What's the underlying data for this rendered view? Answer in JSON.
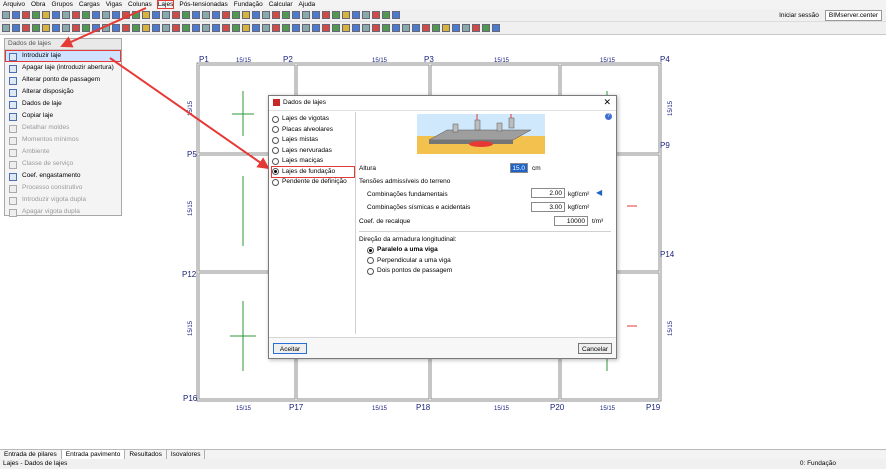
{
  "menu": [
    "Arquivo",
    "Obra",
    "Grupos",
    "Cargas",
    "Vigas",
    "Colunas",
    "Lajes",
    "Pós-tensionadas",
    "Fundação",
    "Calcular",
    "Ajuda"
  ],
  "menu_active_index": 6,
  "right_tools": {
    "login": "Iniciar sessão",
    "server": "BIMserver.center"
  },
  "plan": {
    "pillars": [
      "P1",
      "P2",
      "P3",
      "P4",
      "P5",
      "P9",
      "P12",
      "P14",
      "P16",
      "P17",
      "P18",
      "P20",
      "P19"
    ],
    "section": "15/15"
  },
  "side_menu": {
    "header": "Dados de lajes",
    "items": [
      {
        "label": "Introduzir laje",
        "enabled": true,
        "selected": true
      },
      {
        "label": "Apagar laje (introduzir abertura)",
        "enabled": true
      },
      {
        "label": "Alterar ponto de passagem",
        "enabled": true
      },
      {
        "label": "Alterar disposição",
        "enabled": true
      },
      {
        "label": "Dados de laje",
        "enabled": true
      },
      {
        "label": "Copiar laje",
        "enabled": true
      },
      {
        "label": "Detalhar moldes",
        "enabled": false
      },
      {
        "label": "Momentos mínimos",
        "enabled": false
      },
      {
        "label": "Ambiente",
        "enabled": false
      },
      {
        "label": "Classe de serviço",
        "enabled": false
      },
      {
        "label": "Coef. engastamento",
        "enabled": true
      },
      {
        "label": "Processo construtivo",
        "enabled": false
      },
      {
        "label": "Introduzir vigota dupla",
        "enabled": false
      },
      {
        "label": "Apagar vigota dupla",
        "enabled": false
      }
    ]
  },
  "dialog": {
    "title": "Dados de lajes",
    "types": [
      {
        "label": "Lajes de vigotas",
        "checked": false
      },
      {
        "label": "Placas alveolares",
        "checked": false
      },
      {
        "label": "Lajes mistas",
        "checked": false
      },
      {
        "label": "Lajes nervuradas",
        "checked": false
      },
      {
        "label": "Lajes maciças",
        "checked": false
      },
      {
        "label": "Lajes de fundação",
        "checked": true
      },
      {
        "label": "Pendente de definição",
        "checked": false
      }
    ],
    "altura_label": "Altura",
    "altura_value": "15.0",
    "altura_unit": "cm",
    "tensoes_label": "Tensões admissíveis do terreno",
    "comb_fund_label": "Combinações fundamentais",
    "comb_fund_value": "2.00",
    "comb_sism_label": "Combinações sísmicas e acidentais",
    "comb_sism_value": "3.00",
    "stress_unit": "kgf/cm²",
    "recalque_label": "Coef. de recalque",
    "recalque_value": "10000",
    "recalque_unit": "t/m³",
    "direcao_label": "Direção da armadura longitudinal:",
    "direcao_options": [
      {
        "label": "Paralelo a uma viga",
        "checked": true
      },
      {
        "label": "Perpendicular a uma viga",
        "checked": false
      },
      {
        "label": "Dois pontos de passagem",
        "checked": false
      }
    ],
    "accept": "Aceitar",
    "cancel": "Cancelar"
  },
  "tabs": [
    {
      "label": "Entrada de pilares",
      "active": false
    },
    {
      "label": "Entrada pavimento",
      "active": true
    },
    {
      "label": "Resultados",
      "active": false
    },
    {
      "label": "Isovalores",
      "active": false
    }
  ],
  "status": {
    "left": "Lajes - Dados de lajes",
    "right": "0: Fundação"
  },
  "colors": {
    "highlight": "#e53935",
    "pillar_text": "#1a237e",
    "beam": "#8c8c8c",
    "accent": "#1e64c8"
  }
}
